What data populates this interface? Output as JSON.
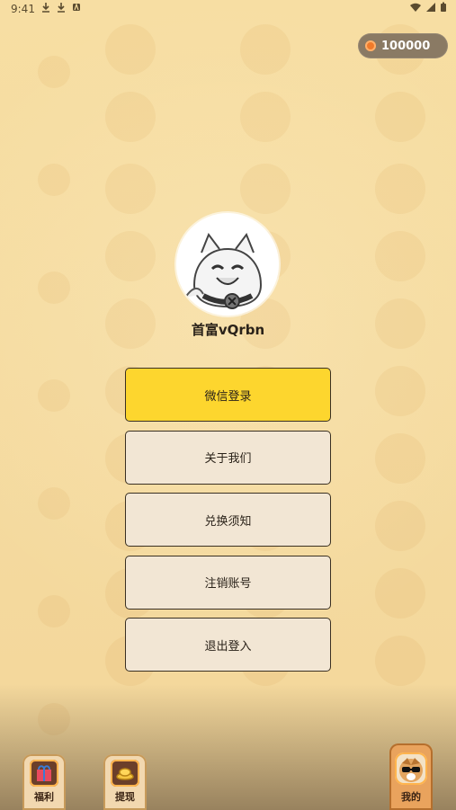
{
  "status_bar": {
    "time": "9:41"
  },
  "header": {
    "coins": "100000"
  },
  "profile": {
    "username": "首富vQrbn"
  },
  "menu": {
    "wechat_login": "微信登录",
    "about_us": "关于我们",
    "exchange_notice": "兑换须知",
    "delete_account": "注销账号",
    "logout": "退出登入"
  },
  "bottom_nav": {
    "tabs": [
      {
        "label": "福利",
        "icon": "gift-icon"
      },
      {
        "label": "提现",
        "icon": "gold-ingot-icon"
      },
      {
        "label": "我的",
        "icon": "dog-sunglasses-icon"
      }
    ],
    "active_index": 2
  },
  "colors": {
    "background": "#f6dc9f",
    "primary_button": "#fdd62e",
    "secondary_button": "#f2e6d4",
    "coin_pill": "#8a7a64"
  }
}
